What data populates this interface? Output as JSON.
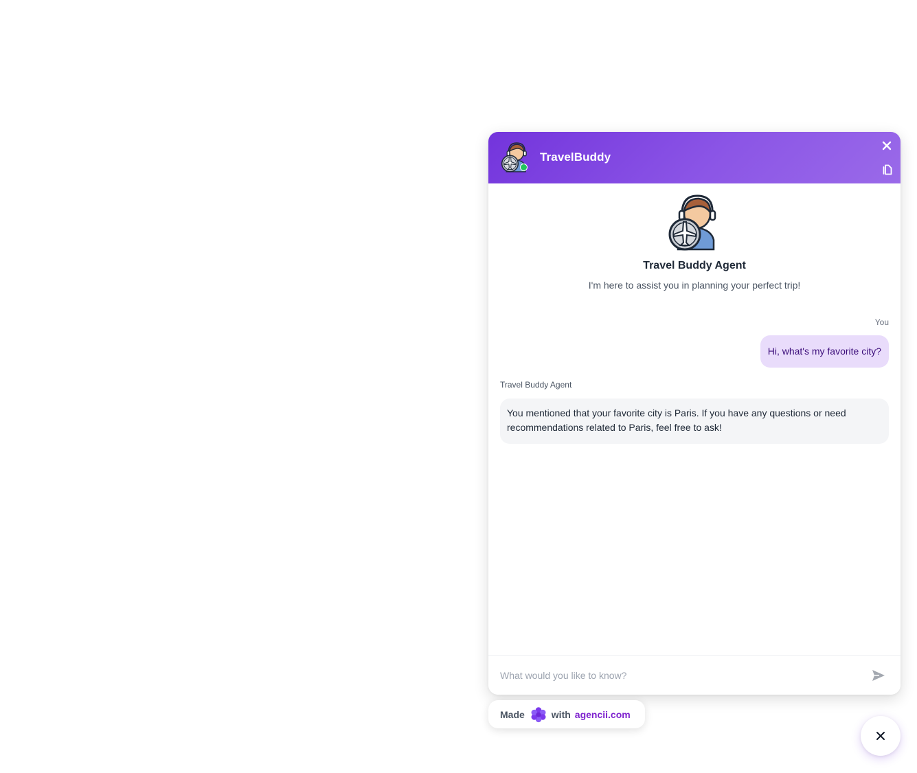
{
  "header": {
    "title": "TravelBuddy",
    "avatar_icon": "travel-agent-avatar-icon",
    "status": "online",
    "close_icon": "close-icon",
    "copy_icon": "copy-icon"
  },
  "intro": {
    "avatar_icon": "travel-agent-avatar-icon",
    "title": "Travel Buddy Agent",
    "subtitle": "I'm here to assist you in planning your perfect trip!"
  },
  "messages": [
    {
      "sender": "You",
      "role": "user",
      "text": "Hi, what's my favorite city?"
    },
    {
      "sender": "Travel Buddy Agent",
      "role": "agent",
      "text": "You mentioned that your favorite city is Paris. If you have any questions or need recommendations related to Paris, feel free to ask!"
    }
  ],
  "input": {
    "value": "",
    "placeholder": "What would you like to know?",
    "send_icon": "send-icon"
  },
  "branding": {
    "made": "Made",
    "with": "with",
    "link": "agencii.com",
    "logo_icon": "flower-logo-icon"
  },
  "launcher": {
    "icon": "close-icon"
  },
  "colors": {
    "accent": "#7334dc",
    "user_bubble": "#e9dcfb",
    "agent_bubble": "#f4f5f7",
    "online": "#22c55e",
    "link": "#7e22ce"
  }
}
